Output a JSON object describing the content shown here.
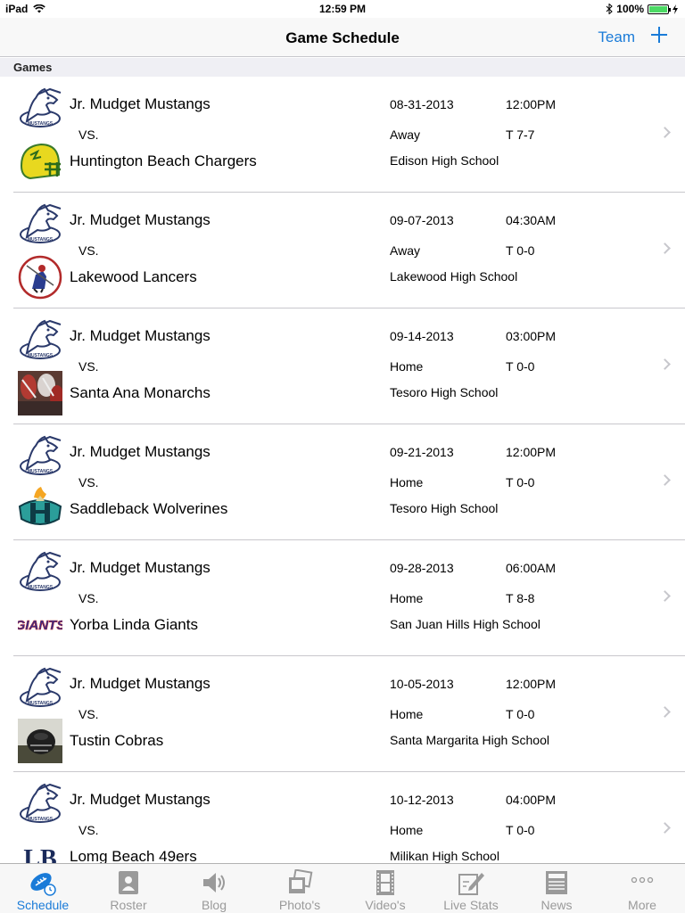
{
  "status": {
    "device": "iPad",
    "time": "12:59 PM",
    "battery": "100%"
  },
  "nav": {
    "title": "Game Schedule",
    "team_label": "Team"
  },
  "section": {
    "title": "Games"
  },
  "games": [
    {
      "home": "Jr. Mudget Mustangs",
      "vs": "VS.",
      "away": "Huntington Beach Chargers",
      "date": "08-31-2013",
      "time": "12:00PM",
      "location": "Away",
      "score": "T 7-7",
      "venue": "Edison High School",
      "away_logo": "chargers-helmet-logo"
    },
    {
      "home": "Jr. Mudget Mustangs",
      "vs": "VS.",
      "away": "Lakewood Lancers",
      "date": "09-07-2013",
      "time": "04:30AM",
      "location": "Away",
      "score": "T 0-0",
      "venue": "Lakewood High School",
      "away_logo": "lancers-knight-logo"
    },
    {
      "home": "Jr. Mudget Mustangs",
      "vs": "VS.",
      "away": "Santa Ana Monarchs",
      "date": "09-14-2013",
      "time": "03:00PM",
      "location": "Home",
      "score": "T 0-0",
      "venue": "Tesoro High School",
      "away_logo": "monarchs-photo"
    },
    {
      "home": "Jr. Mudget Mustangs",
      "vs": "VS.",
      "away": "Saddleback Wolverines",
      "date": "09-21-2013",
      "time": "12:00PM",
      "location": "Home",
      "score": "T 0-0",
      "venue": "Tesoro High School",
      "away_logo": "wolverines-logo"
    },
    {
      "home": "Jr. Mudget Mustangs",
      "vs": "VS.",
      "away": "Yorba Linda Giants",
      "date": "09-28-2013",
      "time": "06:00AM",
      "location": "Home",
      "score": "T 8-8",
      "venue": "San Juan Hills High School",
      "away_logo": "giants-wordmark-logo"
    },
    {
      "home": "Jr. Mudget Mustangs",
      "vs": "VS.",
      "away": "Tustin Cobras",
      "date": "10-05-2013",
      "time": "12:00PM",
      "location": "Home",
      "score": "T 0-0",
      "venue": "Santa Margarita High School",
      "away_logo": "cobras-photo"
    },
    {
      "home": "Jr. Mudget Mustangs",
      "vs": "VS.",
      "away": "Lomg Beach 49ers",
      "date": "10-12-2013",
      "time": "04:00PM",
      "location": "Home",
      "score": "T 0-0",
      "venue": "Milikan High School",
      "away_logo": "lb-logo"
    }
  ],
  "tabs": [
    {
      "label": "Schedule",
      "icon": "football-clock-icon",
      "active": true
    },
    {
      "label": "Roster",
      "icon": "roster-book-icon"
    },
    {
      "label": "Blog",
      "icon": "speaker-icon"
    },
    {
      "label": "Photo's",
      "icon": "photos-icon"
    },
    {
      "label": "Video's",
      "icon": "film-strip-icon"
    },
    {
      "label": "Live Stats",
      "icon": "pencil-note-icon"
    },
    {
      "label": "News",
      "icon": "newspaper-icon"
    },
    {
      "label": "More",
      "icon": "more-dots-icon"
    }
  ],
  "colors": {
    "accent": "#1a7bd8",
    "separator": "#c8c7cc",
    "inactive_tab": "#9a9a9a"
  }
}
